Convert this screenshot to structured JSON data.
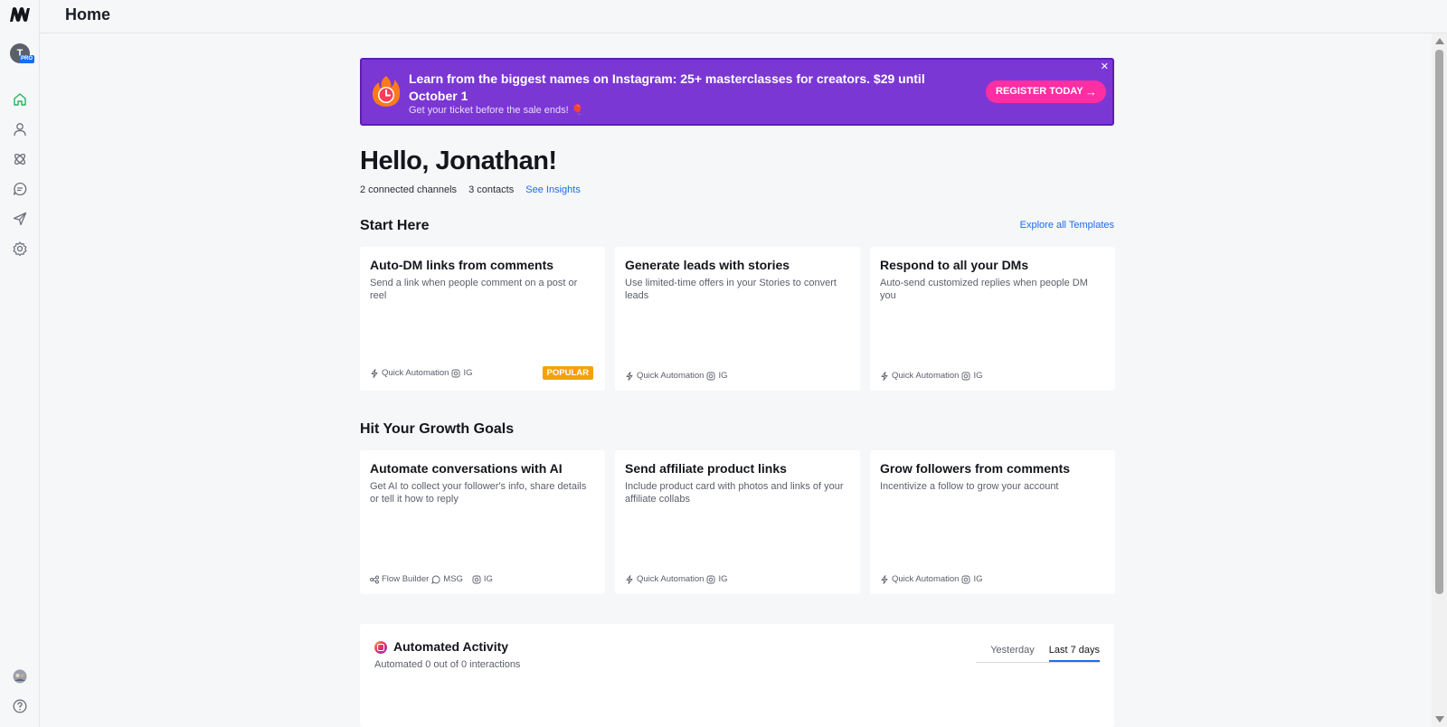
{
  "header": {
    "title": "Home"
  },
  "sidebar": {
    "avatar_initial": "T",
    "pro_badge": "PRO",
    "items": [
      {
        "name": "home",
        "icon": "home-icon",
        "active": true
      },
      {
        "name": "contacts",
        "icon": "person-icon"
      },
      {
        "name": "automation",
        "icon": "automation-icon"
      },
      {
        "name": "messages",
        "icon": "chat-icon"
      },
      {
        "name": "broadcasting",
        "icon": "send-icon"
      },
      {
        "name": "settings",
        "icon": "gear-icon"
      }
    ]
  },
  "banner": {
    "title": "Learn from the biggest names on Instagram: 25+ masterclasses for creators. $29 until October 1",
    "subtitle": "Get your ticket before the sale ends! 🎈",
    "button": "REGISTER TODAY",
    "close": "✕"
  },
  "greeting": {
    "title": "Hello, Jonathan!",
    "channels": "2 connected channels",
    "contacts": "3 contacts",
    "insights_link": "See Insights"
  },
  "start_here": {
    "title": "Start Here",
    "explore_link": "Explore all Templates",
    "cards": [
      {
        "title": "Auto-DM links from comments",
        "desc": "Send a link when people comment on a post or reel",
        "type": "Quick Automation",
        "channel": "IG",
        "badge": "POPULAR"
      },
      {
        "title": "Generate leads with stories",
        "desc": "Use limited-time offers in your Stories to convert leads",
        "type": "Quick Automation",
        "channel": "IG"
      },
      {
        "title": "Respond to all your DMs",
        "desc": "Auto-send customized replies when people DM you",
        "type": "Quick Automation",
        "channel": "IG"
      }
    ]
  },
  "growth": {
    "title": "Hit Your Growth Goals",
    "cards": [
      {
        "title": "Automate conversations with AI",
        "desc": "Get AI to collect your follower's info, share details or tell it how to reply",
        "type": "Flow Builder",
        "channel_msg": "MSG",
        "channel": "IG"
      },
      {
        "title": "Send affiliate product links",
        "desc": "Include product card with photos and links of your affiliate collabs",
        "type": "Quick Automation",
        "channel": "IG"
      },
      {
        "title": "Grow followers from comments",
        "desc": "Incentivize a follow to grow your account",
        "type": "Quick Automation",
        "channel": "IG"
      }
    ]
  },
  "activity": {
    "title": "Automated Activity",
    "subtitle": "Automated 0 out of 0 interactions",
    "tabs": [
      "Yesterday",
      "Last 7 days"
    ],
    "active_tab": "Last 7 days"
  },
  "colors": {
    "accent": "#1d6bf3",
    "banner_bg": "#7b37d4",
    "banner_button": "#ff2ea2",
    "popular_badge": "#f5a10c",
    "home_active": "#22b35e"
  }
}
